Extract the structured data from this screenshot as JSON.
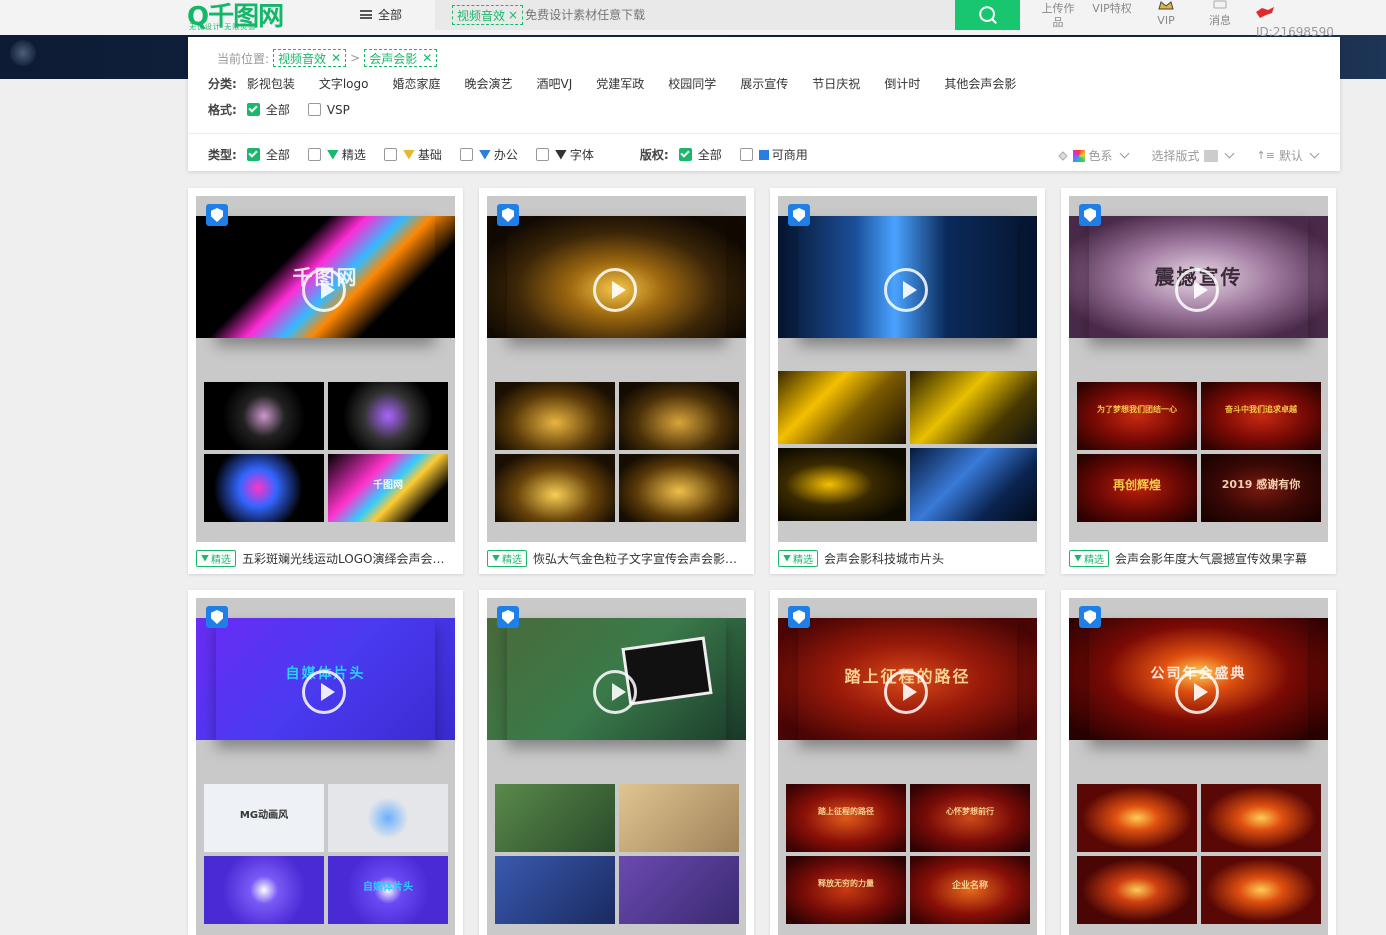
{
  "header": {
    "logo_text": "Q千图网",
    "logo_slogan": "无忧设计 无限灵感",
    "menu_label": "全部",
    "search_tag": "视频音效",
    "search_tag_close": "×",
    "search_placeholder": "免费设计素材任意下载",
    "nav": [
      {
        "label": "上传作品"
      },
      {
        "label": "VIP特权"
      },
      {
        "label": "VIP"
      },
      {
        "label": "消息"
      }
    ],
    "user_id": "ID:21698590"
  },
  "filters": {
    "crumb_label": "当前位置:",
    "crumb_tags": [
      "视频音效",
      "会声会影"
    ],
    "crumb_sep": ">",
    "category_label": "分类:",
    "categories": [
      "影视包装",
      "文字logo",
      "婚恋家庭",
      "晚会演艺",
      "酒吧VJ",
      "党建军政",
      "校园同学",
      "展示宣传",
      "节日庆祝",
      "倒计时",
      "其他会声会影"
    ],
    "format_label": "格式:",
    "formats": [
      {
        "label": "全部",
        "checked": true
      },
      {
        "label": "VSP",
        "checked": false
      }
    ],
    "type_label": "类型:",
    "types": [
      {
        "label": "全部",
        "checked": true
      },
      {
        "label": "精选",
        "checked": false
      },
      {
        "label": "基础",
        "checked": false
      },
      {
        "label": "办公",
        "checked": false
      },
      {
        "label": "字体",
        "checked": false
      }
    ],
    "copyright_label": "版权:",
    "copyrights": [
      {
        "label": "全部",
        "checked": true
      },
      {
        "label": "可商用",
        "checked": false
      }
    ],
    "sort": {
      "color": "色系",
      "layout": "选择版式",
      "order": "默认"
    }
  },
  "cards": [
    {
      "tag": "精选",
      "title": "五彩斑斓光线运动LOGO演绎会声会影模板",
      "main_text": "千图网",
      "grid_text": [
        "",
        "",
        "",
        "千图网"
      ]
    },
    {
      "tag": "精选",
      "title": "恢弘大气金色粒子文字宣传会声会影模板",
      "main_text": "",
      "grid_text": [
        "",
        "",
        "",
        ""
      ]
    },
    {
      "tag": "精选",
      "title": "会声会影科技城市片头",
      "main_text": "",
      "grid_text": [
        "",
        "",
        "",
        ""
      ]
    },
    {
      "tag": "精选",
      "title": "会声会影年度大气震撼宣传效果字幕",
      "main_text": "震撼宣传",
      "grid_text": [
        "为了梦想我们团结一心",
        "奋斗中我们追求卓越",
        "再创辉煌",
        "2019 感谢有你"
      ]
    },
    {
      "tag": "",
      "title": "",
      "main_text": "自媒体片头",
      "grid_text": [
        "MG动画风",
        "",
        "",
        "自媒体片头"
      ]
    },
    {
      "tag": "",
      "title": "",
      "main_text": "",
      "grid_text": [
        "",
        "",
        "",
        ""
      ]
    },
    {
      "tag": "",
      "title": "",
      "main_text": "踏上征程的路径",
      "grid_text": [
        "踏上征程的路径",
        "心怀梦想前行",
        "释放无穷的力量",
        "企业名称"
      ]
    },
    {
      "tag": "",
      "title": "",
      "main_text": "公司年会盛典",
      "grid_text": [
        "",
        "",
        "",
        ""
      ]
    }
  ],
  "colors": {
    "brand": "#17c66f",
    "badge": "#1e7fe8"
  }
}
